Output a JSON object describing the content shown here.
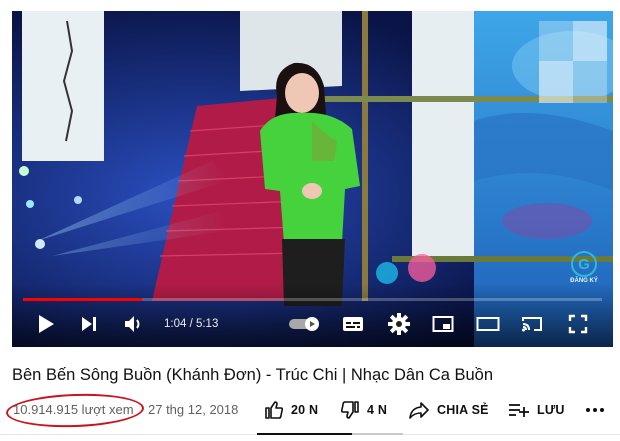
{
  "video": {
    "current_time": "1:04",
    "total_time": "5:13",
    "time_text": "1:04 / 5:13",
    "played_fraction": 0.205,
    "loaded_fraction": 0.205,
    "logo_text": "ĐĂNG KÝ",
    "colors": {
      "progress_played": "#ff0000",
      "logo_accent": "#2fb9d8"
    }
  },
  "controls": {
    "play": "play-icon",
    "next": "next-icon",
    "volume": "volume-icon",
    "autoplay": "autoplay-toggle-icon",
    "subtitles": "subtitles-icon",
    "settings": "gear-icon",
    "miniplayer": "miniplayer-icon",
    "theater": "theater-mode-icon",
    "cast": "cast-icon",
    "fullscreen": "fullscreen-icon"
  },
  "details": {
    "title": "Bên Bến Sông Buồn (Khánh Đơn) - Trúc Chi | Nhạc Dân Ca Buồn",
    "views": "10.914.915 lượt xem",
    "date": "27 thg 12, 2018",
    "highlight_color": "#c8141e"
  },
  "actions": {
    "like_count": "20 N",
    "dislike_count": "4 N",
    "share_label": "CHIA SẺ",
    "save_label": "LƯU",
    "more": "more-icon"
  }
}
